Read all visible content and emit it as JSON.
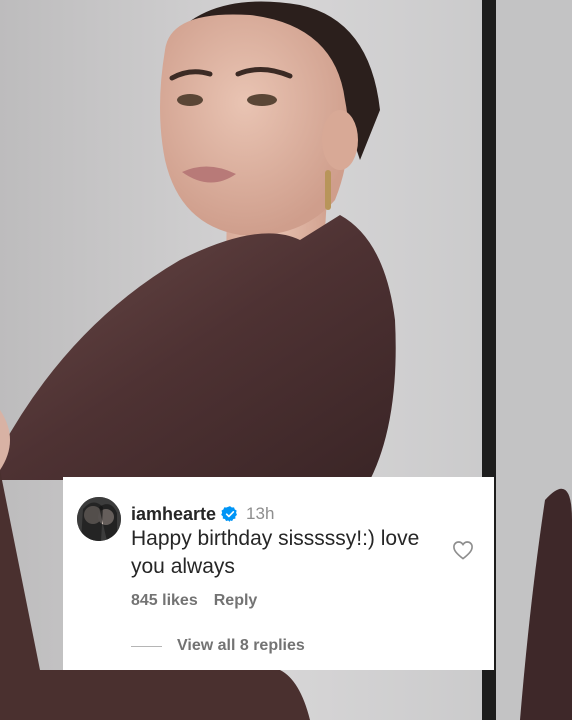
{
  "comment": {
    "username": "iamhearte",
    "time": "13h",
    "text": "Happy birthday sisssssy!:) love you always",
    "likes": "845 likes",
    "reply_label": "Reply",
    "view_replies": "View all 8 replies"
  },
  "icons": {
    "verified": "verified-badge-icon",
    "like": "heart-outline-icon"
  },
  "colors": {
    "verified_blue": "#0095f6",
    "text_primary": "#262626",
    "text_secondary": "#737373"
  }
}
